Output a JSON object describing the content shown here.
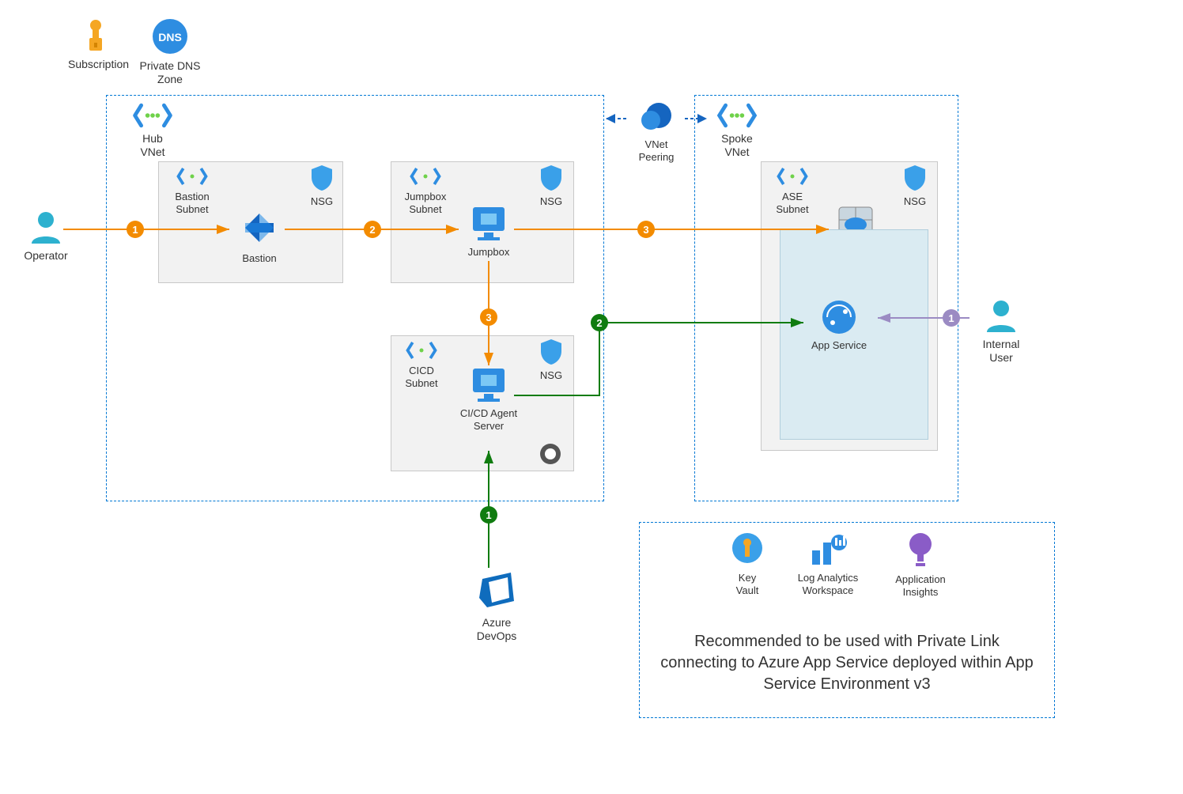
{
  "top_icons": {
    "subscription": "Subscription",
    "private_dns_zone": "Private DNS Zone"
  },
  "hub": {
    "vnet_label": "Hub\nVNet",
    "bastion_subnet": "Bastion\nSubnet",
    "bastion_nsg": "NSG",
    "bastion": "Bastion",
    "jumpbox_subnet": "Jumpbox\nSubnet",
    "jumpbox_nsg": "NSG",
    "jumpbox": "Jumpbox",
    "cicd_subnet": "CICD\nSubnet",
    "cicd_nsg": "NSG",
    "cicd_server": "CI/CD Agent\nServer"
  },
  "peering": "VNet\nPeering",
  "spoke": {
    "vnet_label": "Spoke\nVNet",
    "ase_subnet": "ASE\nSubnet",
    "nsg": "NSG",
    "ase": "ASE v3",
    "app_service": "App Service"
  },
  "actors": {
    "operator": "Operator",
    "internal_user": "Internal\nUser",
    "azure_devops": "Azure\nDevOps"
  },
  "legend": {
    "key_vault": "Key\nVault",
    "log_analytics": "Log Analytics\nWorkspace",
    "app_insights": "Application\nInsights",
    "recommendation": "Recommended to be used with Private Link connecting to Azure App Service deployed within App Service Environment v3"
  },
  "flows": {
    "operator_path": [
      "1",
      "2",
      "3"
    ],
    "devops_path": [
      "1",
      "2"
    ],
    "jumpbox_to_cicd": "3",
    "user_path": [
      "1"
    ]
  },
  "colors": {
    "azure_blue": "#0078d4",
    "orange": "#f38b00",
    "green": "#107c10",
    "purple": "#9b8bc3",
    "cyan": "#2db1cf"
  }
}
